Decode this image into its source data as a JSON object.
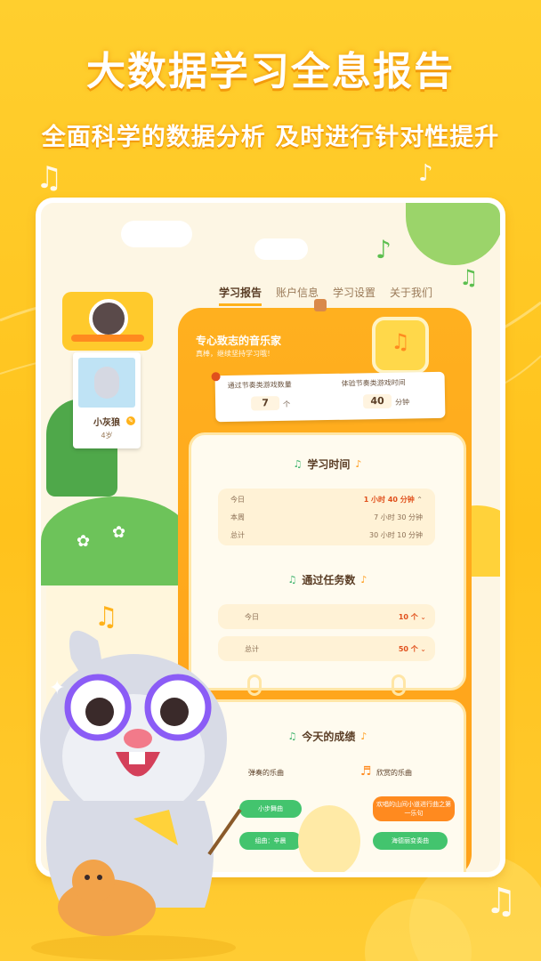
{
  "promo": {
    "headline": "大数据学习全息报告",
    "subline": "全面科学的数据分析 及时进行针对性提升"
  },
  "nav": {
    "tabs": [
      "学习报告",
      "账户信息",
      "学习设置",
      "关于我们"
    ],
    "active_index": 0
  },
  "profile": {
    "name": "小灰狼",
    "age": "4岁"
  },
  "report": {
    "title": "专心致志的音乐家",
    "subtitle": "真棒，继续坚持学习哦！",
    "stats": [
      {
        "label": "通过节奏类游戏数量",
        "value": "7",
        "unit": "个"
      },
      {
        "label": "体验节奏类游戏时间",
        "value": "40",
        "unit": "分钟"
      }
    ]
  },
  "study_time": {
    "title": "学习时间",
    "rows": [
      {
        "label": "今日",
        "value": "1 小时 40 分钟"
      },
      {
        "label": "本周",
        "value": "7 小时 30 分钟"
      },
      {
        "label": "总计",
        "value": "30 小时 10 分钟"
      }
    ]
  },
  "tasks": {
    "title": "通过任务数",
    "rows": [
      {
        "label": "今日",
        "value": "10 个"
      },
      {
        "label": "总计",
        "value": "50 个"
      }
    ]
  },
  "achievements": {
    "title": "今天的成绩",
    "played_label": "弹奏的乐曲",
    "enjoyed_label": "欣赏的乐曲",
    "played_songs": [
      "小步舞曲",
      "组曲：辛晨"
    ],
    "enjoyed_songs": [
      "欢唱的山间小道进行曲之第一乐句",
      "海德丽变奏曲"
    ]
  },
  "colors": {
    "background": "#ffc21c",
    "card_orange": "#ffa11a",
    "accent_red": "#e0501c",
    "green": "#43c46e"
  }
}
